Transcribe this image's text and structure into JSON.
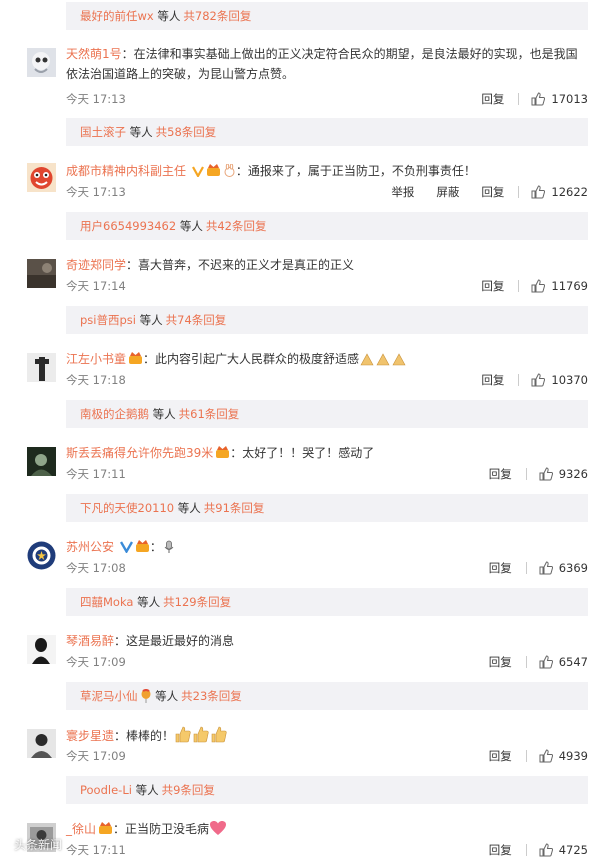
{
  "reply_bars": [
    {
      "user": "最好的前任wx",
      "mid": "等人",
      "count": "共782条回复"
    },
    {
      "user": "国土滚子",
      "mid": "等人",
      "count": "共58条回复"
    },
    {
      "user": "用户6654993462",
      "mid": "等人",
      "count": "共42条回复"
    },
    {
      "user": "psi普西psi",
      "mid": "等人",
      "count": "共74条回复"
    },
    {
      "user": "南极的企鹅鹅",
      "mid": "等人",
      "count": "共61条回复"
    },
    {
      "user": "下凡的天使20110",
      "mid": "等人",
      "count": "共91条回复"
    },
    {
      "user": "四囍Moka",
      "mid": "等人",
      "count": "共129条回复"
    },
    {
      "user": "草泥马小仙",
      "mid": "等人",
      "count": "共23条回复"
    },
    {
      "user": "Poodle-Li",
      "mid": "等人",
      "count": "共9条回复"
    }
  ],
  "comments": [
    {
      "author": "天然萌1号",
      "text": "：在法律和事实基础上做出的正义决定符合民众的期望，是良法最好的实现，也是我国依法治国道路上的突破，为昆山警方点赞。",
      "time": "今天 17:13",
      "reply": "回复",
      "likes": "17013"
    },
    {
      "author": "成都市精神内科副主任",
      "text": "：通报来了，属于正当防卫，不负刑事责任！",
      "time": "今天 17:13",
      "report": "举报",
      "block": "屏蔽",
      "reply": "回复",
      "likes": "12622"
    },
    {
      "author": "奇迹郑同学",
      "text": "：喜大普奔，不迟来的正义才是真正的正义",
      "time": "今天 17:14",
      "reply": "回复",
      "likes": "11769"
    },
    {
      "author": "江左小书童",
      "text": "：此内容引起广大人民群众的极度舒适感",
      "time": "今天 17:18",
      "reply": "回复",
      "likes": "10370"
    },
    {
      "author": "斯丢丢痛得允许你先跑39米",
      "text": "：太好了！！哭了！感动了",
      "time": "今天 17:11",
      "reply": "回复",
      "likes": "9326"
    },
    {
      "author": "苏州公安",
      "text": "：",
      "time": "今天 17:08",
      "reply": "回复",
      "likes": "6369"
    },
    {
      "author": "琴酒易醉",
      "text": "：这是最近最好的消息",
      "time": "今天 17:09",
      "reply": "回复",
      "likes": "6547"
    },
    {
      "author": "寰步星遗",
      "text": "：棒棒的！",
      "time": "今天 17:09",
      "reply": "回复",
      "likes": "4939"
    },
    {
      "author": "_徐山",
      "text": "：正当防卫没毛病",
      "time": "今天 17:11",
      "reply": "回复",
      "likes": "4725"
    }
  ],
  "watermark": "头条新闻",
  "colors": {
    "accent": "#eb7350",
    "reply_bg": "#f2f2f5",
    "time": "#808080"
  }
}
